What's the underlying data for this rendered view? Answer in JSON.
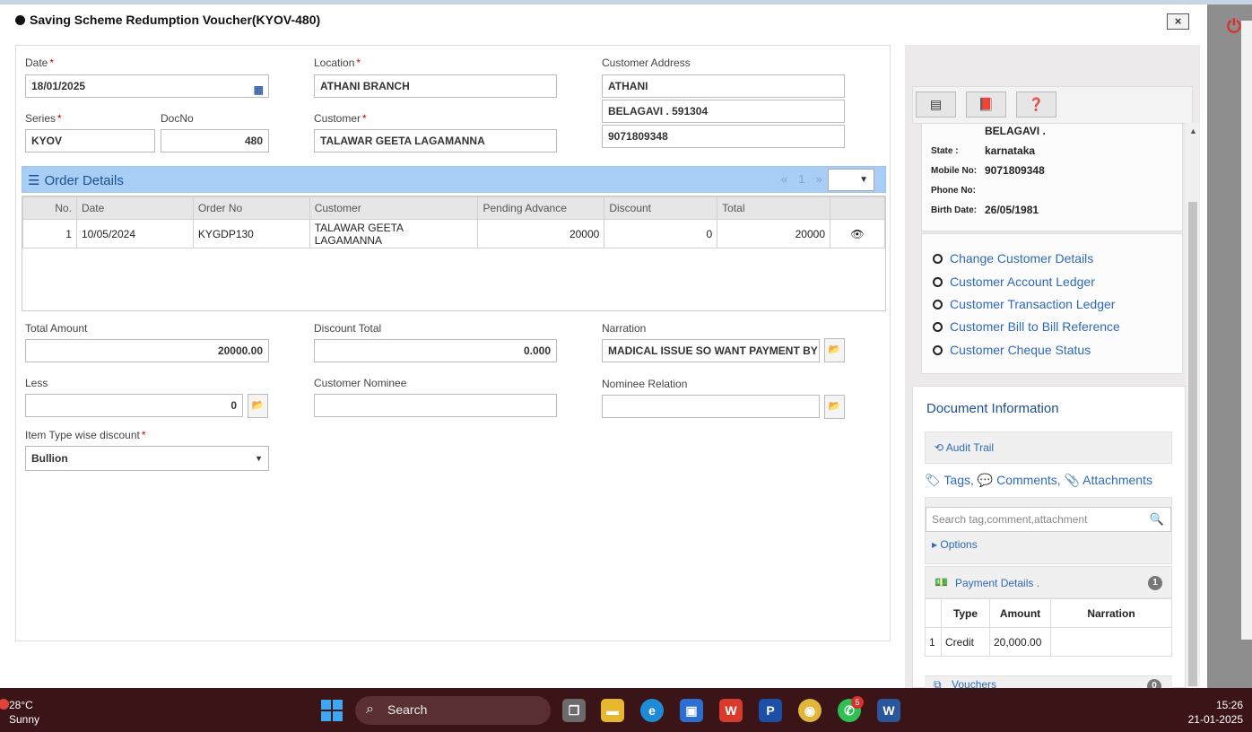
{
  "modal": {
    "title": "Saving Scheme Redumption Voucher(KYOV-480)",
    "close_label": "×"
  },
  "form": {
    "date_label": "Date",
    "date_value": "18/01/2025",
    "location_label": "Location",
    "location_value": "ATHANI BRANCH",
    "address_label": "Customer Address",
    "address_line1": "ATHANI",
    "address_line2": "BELAGAVI . 591304",
    "address_line3": "9071809348",
    "series_label": "Series",
    "series_value": "KYOV",
    "docno_label": "DocNo",
    "docno_value": "480",
    "customer_label": "Customer",
    "customer_value": "TALAWAR GEETA LAGAMANNA",
    "total_amount_label": "Total Amount",
    "total_amount_value": "20000.00",
    "discount_total_label": "Discount Total",
    "discount_total_value": "0.000",
    "narration_label": "Narration",
    "narration_value": "MADICAL ISSUE SO WANT PAYMENT BY",
    "less_label": "Less",
    "less_value": "0",
    "nominee_label": "Customer Nominee",
    "nominee_value": "",
    "nominee_relation_label": "Nominee Relation",
    "nominee_relation_value": "",
    "item_type_label": "Item Type wise discount",
    "item_type_value": "Bullion"
  },
  "order_details": {
    "title": "Order Details",
    "pager_prev": "«",
    "pager_page": "1",
    "pager_next": "»",
    "columns": [
      "No.",
      "Date",
      "Order No",
      "Customer",
      "Pending Advance",
      "Discount",
      "Total"
    ],
    "rows": [
      {
        "no": "1",
        "date": "10/05/2024",
        "order_no": "KYGDP130",
        "customer": "TALAWAR GEETA LAGAMANNA",
        "pending_advance": "20000",
        "discount": "0",
        "total": "20000"
      }
    ]
  },
  "customer_info": {
    "city": "BELAGAVI .",
    "state_label": "State :",
    "state_value": "karnataka",
    "mobile_label": "Mobile No:",
    "mobile_value": "9071809348",
    "phone_label": "Phone No:",
    "phone_value": "",
    "birth_label": "Birth Date:",
    "birth_value": "26/05/1981"
  },
  "customer_links": [
    "Change Customer Details",
    "Customer Account Ledger",
    "Customer Transaction Ledger",
    "Customer Bill to Bill Reference",
    "Customer Cheque Status"
  ],
  "doc_info": {
    "title": "Document Information",
    "audit_trail": "Audit Trail",
    "tags": "Tags,",
    "comments": "Comments,",
    "attachments": "Attachments",
    "search_placeholder": "Search tag,comment,attachment",
    "options": "Options",
    "payment_details": "Payment Details .",
    "payment_count": "1",
    "payment_columns": [
      "Type",
      "Amount",
      "Narration"
    ],
    "payment_rows": [
      {
        "no": "1",
        "type": "Credit",
        "amount": "20,000.00",
        "narration": ""
      }
    ],
    "vouchers": "Vouchers",
    "vouchers_count": "0"
  },
  "taskbar": {
    "temp": "28°C",
    "weather": "Sunny",
    "search": "Search",
    "whatsapp_badge": "5",
    "time": "15:26",
    "date": "21-01-2025"
  },
  "colors": {
    "accent": "#2e6ab8",
    "header_blue": "#a8cef5",
    "required": "#cc0000",
    "taskbar": "#3b1417"
  }
}
